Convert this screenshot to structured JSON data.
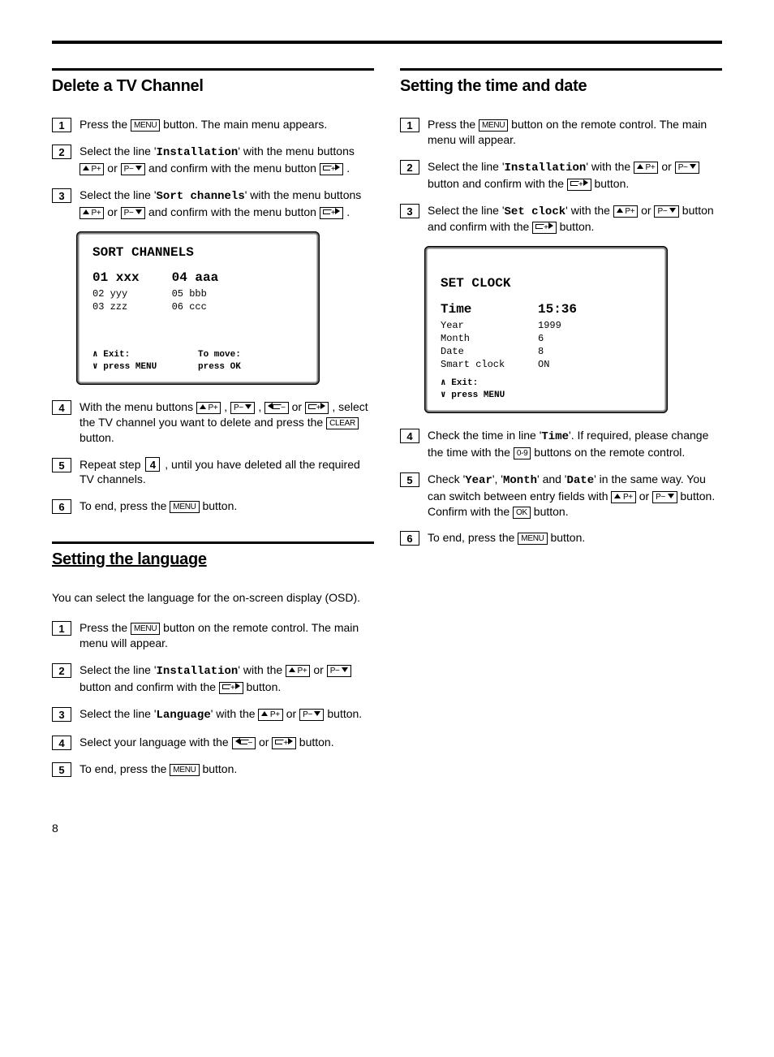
{
  "page_number": "8",
  "buttons": {
    "menu": "MENU",
    "p_up": "P+",
    "p_down": "P−",
    "right": "+",
    "left": "−",
    "clear": "CLEAR",
    "num": "0-9",
    "ok": "OK"
  },
  "left": {
    "delete": {
      "heading": "Delete a TV Channel",
      "steps": {
        "s1a": "Press the ",
        "s1b": " button. The main menu appears.",
        "s2a": "Select the line '",
        "s2m": "Installation",
        "s2b": "' with the menu buttons ",
        "s2c": " or ",
        "s2d": " and confirm with the menu button ",
        "s2e": " .",
        "s3a": "Select the line '",
        "s3m": "Sort channels",
        "s3b": "' with the menu buttons ",
        "s3c": " or ",
        "s3d": " and confirm with the menu button ",
        "s3e": " .",
        "s4a": "With the menu buttons ",
        "s4b": " , ",
        "s4c": " , ",
        "s4d": " or ",
        "s4e": " , select the TV channel you want to delete and press the ",
        "s4f": " button.",
        "s5a": "Repeat step ",
        "s5num": "4",
        "s5b": " ,  until you have deleted all the required TV channels.",
        "s6a": "To end, press the ",
        "s6b": " button."
      },
      "screen": {
        "title": "SORT CHANNELS",
        "left_big": "01 xxx",
        "left_rows": [
          "02 yyy",
          "03 zzz"
        ],
        "right_big": "04 aaa",
        "right_rows": [
          "05 bbb",
          "06 ccc"
        ],
        "footer_left_1": "∧ Exit:",
        "footer_left_2": "∨ press MENU",
        "footer_right_1": "To move:",
        "footer_right_2": "press OK"
      }
    },
    "language": {
      "heading": "Setting the language",
      "intro": "You can select the language for the on-screen display (OSD).",
      "steps": {
        "s1a": "Press the ",
        "s1b": " button on the remote control. The main menu will appear.",
        "s2a": "Select the line '",
        "s2m": "Installation",
        "s2b": "' with the ",
        "s2c": " or ",
        "s2d": " button and confirm with the ",
        "s2e": " button.",
        "s3a": "Select the line '",
        "s3m": "Language",
        "s3b": "' with the ",
        "s3c": " or ",
        "s3d": " button.",
        "s4a": "Select your language with the ",
        "s4b": " or ",
        "s4c": " button.",
        "s5a": "To end, press the ",
        "s5b": " button."
      }
    }
  },
  "right": {
    "clock": {
      "heading": "Setting the time and date",
      "steps": {
        "s1a": "Press the ",
        "s1b": " button on the remote control. The main menu will appear.",
        "s2a": "Select the line '",
        "s2m": "Installation",
        "s2b": "' with the ",
        "s2c": " or ",
        "s2d": " button and confirm with the ",
        "s2e": " button.",
        "s3a": "Select the line '",
        "s3m": "Set clock",
        "s3b": "' with the ",
        "s3c": " or ",
        "s3d": " button and confirm with the ",
        "s3e": " button.",
        "s4a": "Check the time in line '",
        "s4m": "Time",
        "s4b": "'. If required, please change the time with the ",
        "s4c": " buttons on the remote control.",
        "s5a": "Check '",
        "s5m1": "Year",
        "s5b": "', '",
        "s5m2": "Month",
        "s5c": "' and '",
        "s5m3": "Date",
        "s5d": "' in the same way. You can switch between entry fields with ",
        "s5e": " or ",
        "s5f": " button. Confirm with the ",
        "s5g": " button.",
        "s6a": "To end, press the ",
        "s6b": " button."
      },
      "screen": {
        "title": "SET CLOCK",
        "rows": [
          {
            "label": "Time",
            "value": "15:36",
            "big": true
          },
          {
            "label": "Year",
            "value": "1999"
          },
          {
            "label": "Month",
            "value": "6"
          },
          {
            "label": "Date",
            "value": "8"
          },
          {
            "label": "Smart clock",
            "value": "ON"
          }
        ],
        "footer_left_1": "∧ Exit:",
        "footer_left_2": "∨ press MENU"
      }
    }
  }
}
